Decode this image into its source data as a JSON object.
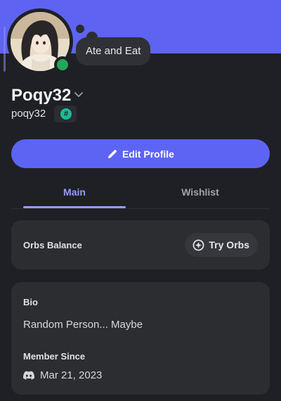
{
  "status": {
    "custom_status": "Ate and Eat",
    "presence": "online",
    "presence_color": "#23a55a"
  },
  "profile": {
    "display_name": "Poqy32",
    "username": "poqy32",
    "tag_symbol": "#",
    "tag_color": "#1fb998",
    "banner_color": "#5e63f1"
  },
  "actions": {
    "edit_profile_label": "Edit Profile",
    "edit_icon": "pencil-icon"
  },
  "tabs": [
    {
      "label": "Main",
      "active": true
    },
    {
      "label": "Wishlist",
      "active": false
    }
  ],
  "orbs": {
    "label": "Orbs Balance",
    "button_label": "Try Orbs",
    "icon": "orb-icon"
  },
  "bio": {
    "title": "Bio",
    "text": "Random Person... Maybe"
  },
  "member_since": {
    "title": "Member Since",
    "date": "Mar 21, 2023",
    "icon": "discord-icon"
  }
}
